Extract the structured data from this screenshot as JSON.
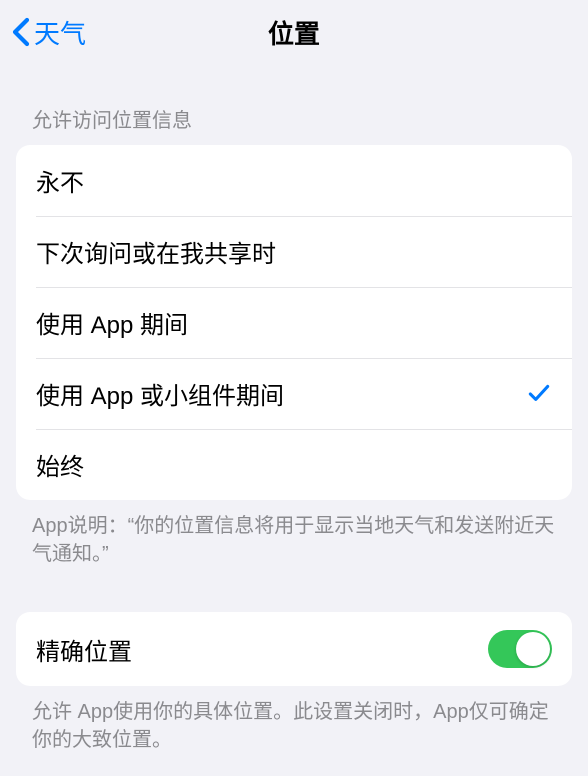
{
  "nav": {
    "back_label": "天气",
    "title": "位置"
  },
  "location_access": {
    "header": "允许访问位置信息",
    "options": [
      {
        "label": "永不",
        "selected": false
      },
      {
        "label": "下次询问或在我共享时",
        "selected": false
      },
      {
        "label": "使用 App 期间",
        "selected": false
      },
      {
        "label": "使用 App 或小组件期间",
        "selected": true
      },
      {
        "label": "始终",
        "selected": false
      }
    ],
    "footer": "App说明：“你的位置信息将用于显示当地天气和发送附近天气通知。”"
  },
  "precise_location": {
    "label": "精确位置",
    "enabled": true,
    "footer": "允许 App使用你的具体位置。此设置关闭时，App仅可确定你的大致位置。"
  }
}
